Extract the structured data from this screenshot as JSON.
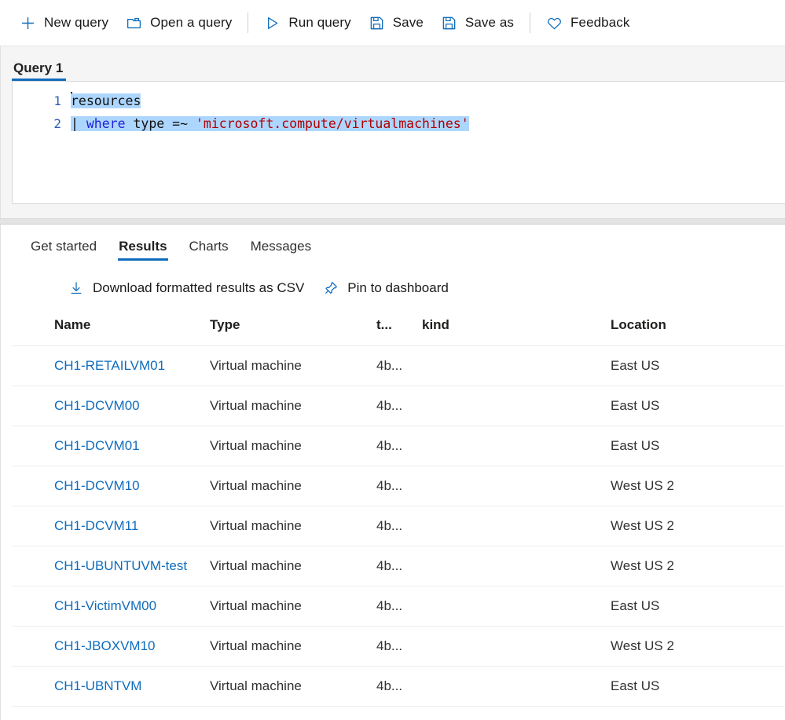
{
  "toolbar": {
    "items": [
      {
        "label": "New query",
        "icon": "plus-icon",
        "name": "new-query"
      },
      {
        "label": "Open a query",
        "icon": "folder-icon",
        "name": "open-query"
      },
      {
        "label": "Run query",
        "icon": "play-icon",
        "name": "run-query"
      },
      {
        "label": "Save",
        "icon": "save-icon",
        "name": "save"
      },
      {
        "label": "Save as",
        "icon": "save-as-icon",
        "name": "save-as"
      },
      {
        "label": "Feedback",
        "icon": "heart-icon",
        "name": "feedback"
      }
    ]
  },
  "editor": {
    "tab_label": "Query 1",
    "line_numbers": [
      "1",
      "2"
    ],
    "lines": [
      {
        "number": "1",
        "text": "resources"
      },
      {
        "number": "2",
        "text": "| where type =~ 'microsoft.compute/virtualmachines'"
      }
    ],
    "line2_tokens": {
      "pipe": "| ",
      "keyword": "where",
      "plain": " type =~ ",
      "string": "'microsoft.compute/virtualmachines'"
    },
    "selection_active": true
  },
  "results": {
    "tabs": [
      {
        "label": "Get started",
        "active": false
      },
      {
        "label": "Results",
        "active": true
      },
      {
        "label": "Charts",
        "active": false
      },
      {
        "label": "Messages",
        "active": false
      }
    ],
    "actions": [
      {
        "label": "Download formatted results as CSV",
        "icon": "download-icon",
        "name": "download-csv"
      },
      {
        "label": "Pin to dashboard",
        "icon": "pin-icon",
        "name": "pin-to-dashboard"
      }
    ],
    "columns": [
      "Name",
      "Type",
      "t...",
      "kind",
      "Location"
    ],
    "rows": [
      {
        "name": "CH1-RETAILVM01",
        "type": "Virtual machine",
        "t": "4b...",
        "kind": "",
        "location": "East US"
      },
      {
        "name": "CH1-DCVM00",
        "type": "Virtual machine",
        "t": "4b...",
        "kind": "",
        "location": "East US"
      },
      {
        "name": "CH1-DCVM01",
        "type": "Virtual machine",
        "t": "4b...",
        "kind": "",
        "location": "East US"
      },
      {
        "name": "CH1-DCVM10",
        "type": "Virtual machine",
        "t": "4b...",
        "kind": "",
        "location": "West US 2"
      },
      {
        "name": "CH1-DCVM11",
        "type": "Virtual machine",
        "t": "4b...",
        "kind": "",
        "location": "West US 2"
      },
      {
        "name": "CH1-UBUNTUVM-test",
        "type": "Virtual machine",
        "t": "4b...",
        "kind": "",
        "location": "West US 2"
      },
      {
        "name": "CH1-VictimVM00",
        "type": "Virtual machine",
        "t": "4b...",
        "kind": "",
        "location": "East US"
      },
      {
        "name": "CH1-JBOXVM10",
        "type": "Virtual machine",
        "t": "4b...",
        "kind": "",
        "location": "West US 2"
      },
      {
        "name": "CH1-UBNTVM",
        "type": "Virtual machine",
        "t": "4b...",
        "kind": "",
        "location": "East US"
      }
    ]
  },
  "colors": {
    "accent": "#0f6cbd",
    "link": "#0f6cbd",
    "selection": "#add6ff",
    "keyword": "#1f1fd6",
    "string": "#b00000",
    "panel_bg": "#f5f5f5"
  }
}
